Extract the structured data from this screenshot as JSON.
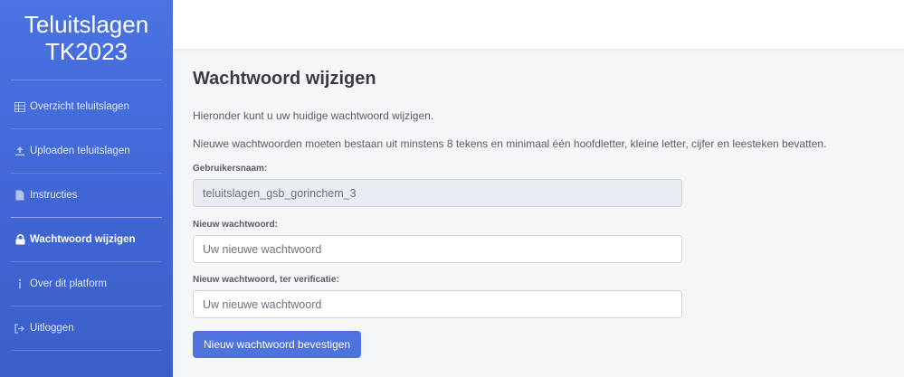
{
  "sidebar": {
    "brand_line1": "Teluitslagen",
    "brand_line2": "TK2023",
    "items": [
      {
        "label": "Overzicht teluitslagen",
        "icon": "table-icon"
      },
      {
        "label": "Uploaden teluitslagen",
        "icon": "upload-icon"
      },
      {
        "label": "Instructies",
        "icon": "document-icon"
      },
      {
        "label": "Wachtwoord wijzigen",
        "icon": "lock-icon",
        "active": true
      },
      {
        "label": "Over dit platform",
        "icon": "info-icon"
      },
      {
        "label": "Uitloggen",
        "icon": "logout-icon"
      }
    ]
  },
  "main": {
    "title": "Wachtwoord wijzigen",
    "intro": "Hieronder kunt u uw huidige wachtwoord wijzigen.",
    "requirements": "Nieuwe wachtwoorden moeten bestaan uit minstens 8 tekens en minimaal één hoofdletter, kleine letter, cijfer en leesteken bevatten.",
    "username_label": "Gebruikersnaam:",
    "username_value": "teluitslagen_gsb_gorinchem_3",
    "new_password_label": "Nieuw wachtwoord:",
    "new_password_placeholder": "Uw nieuwe wachtwoord",
    "verify_password_label": "Nieuw wachtwoord, ter verificatie:",
    "verify_password_placeholder": "Uw nieuwe wachtwoord",
    "submit_label": "Nieuw wachtwoord bevestigen"
  },
  "colors": {
    "sidebar": "#4a72e0",
    "primary": "#4e73df",
    "readonly_bg": "#eaecf4"
  }
}
